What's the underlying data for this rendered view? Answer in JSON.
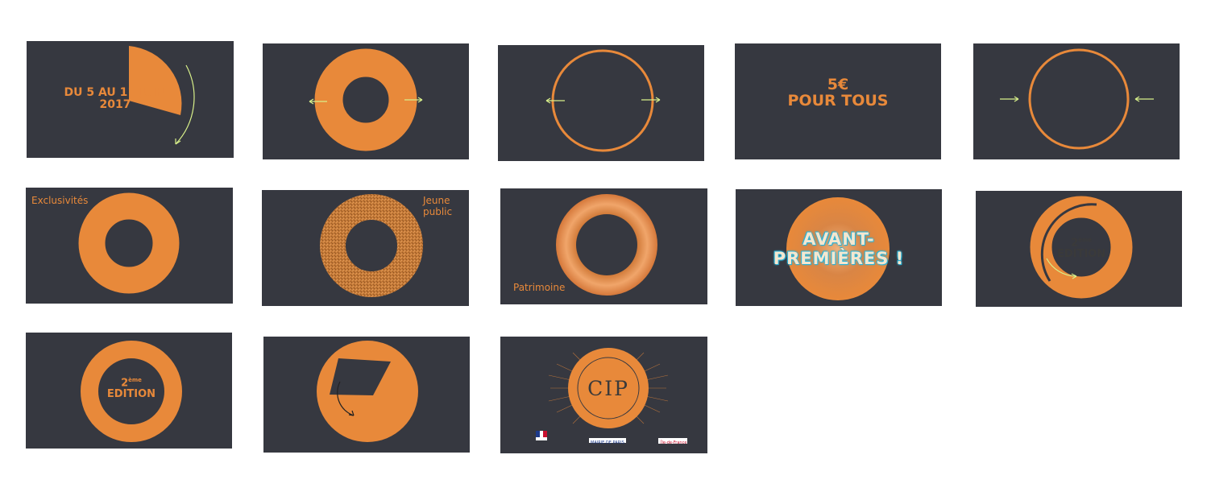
{
  "colors": {
    "background": "#ffffff",
    "frame": "#363840",
    "accent": "#e8893a",
    "arrow": "#d8f08a"
  },
  "frames": {
    "f1": {
      "line1": "DU 5 AU 11 JUIN",
      "line2": "2017"
    },
    "f4": {
      "line1": "5€",
      "line2": "POUR TOUS"
    },
    "f6": {
      "label": "Exclusivités"
    },
    "f7": {
      "label": "Jeune\npublic"
    },
    "f8": {
      "label": "Patrimoine"
    },
    "f9": {
      "line1": "AVANT-",
      "line2": "PREMIÈRES !"
    },
    "f10": {
      "ordinal": "2",
      "suffix": "ème",
      "word": "EDITION"
    },
    "f11": {
      "ordinal": "2",
      "suffix": "ème",
      "word": "EDITION"
    },
    "f13": {
      "logo": "CIP",
      "ring_text": "CINÉMAS INDÉPENDANTS PARISIENS",
      "sponsor2": "MAIRIE DE PARIS",
      "sponsor3": "Île-de-France"
    }
  }
}
